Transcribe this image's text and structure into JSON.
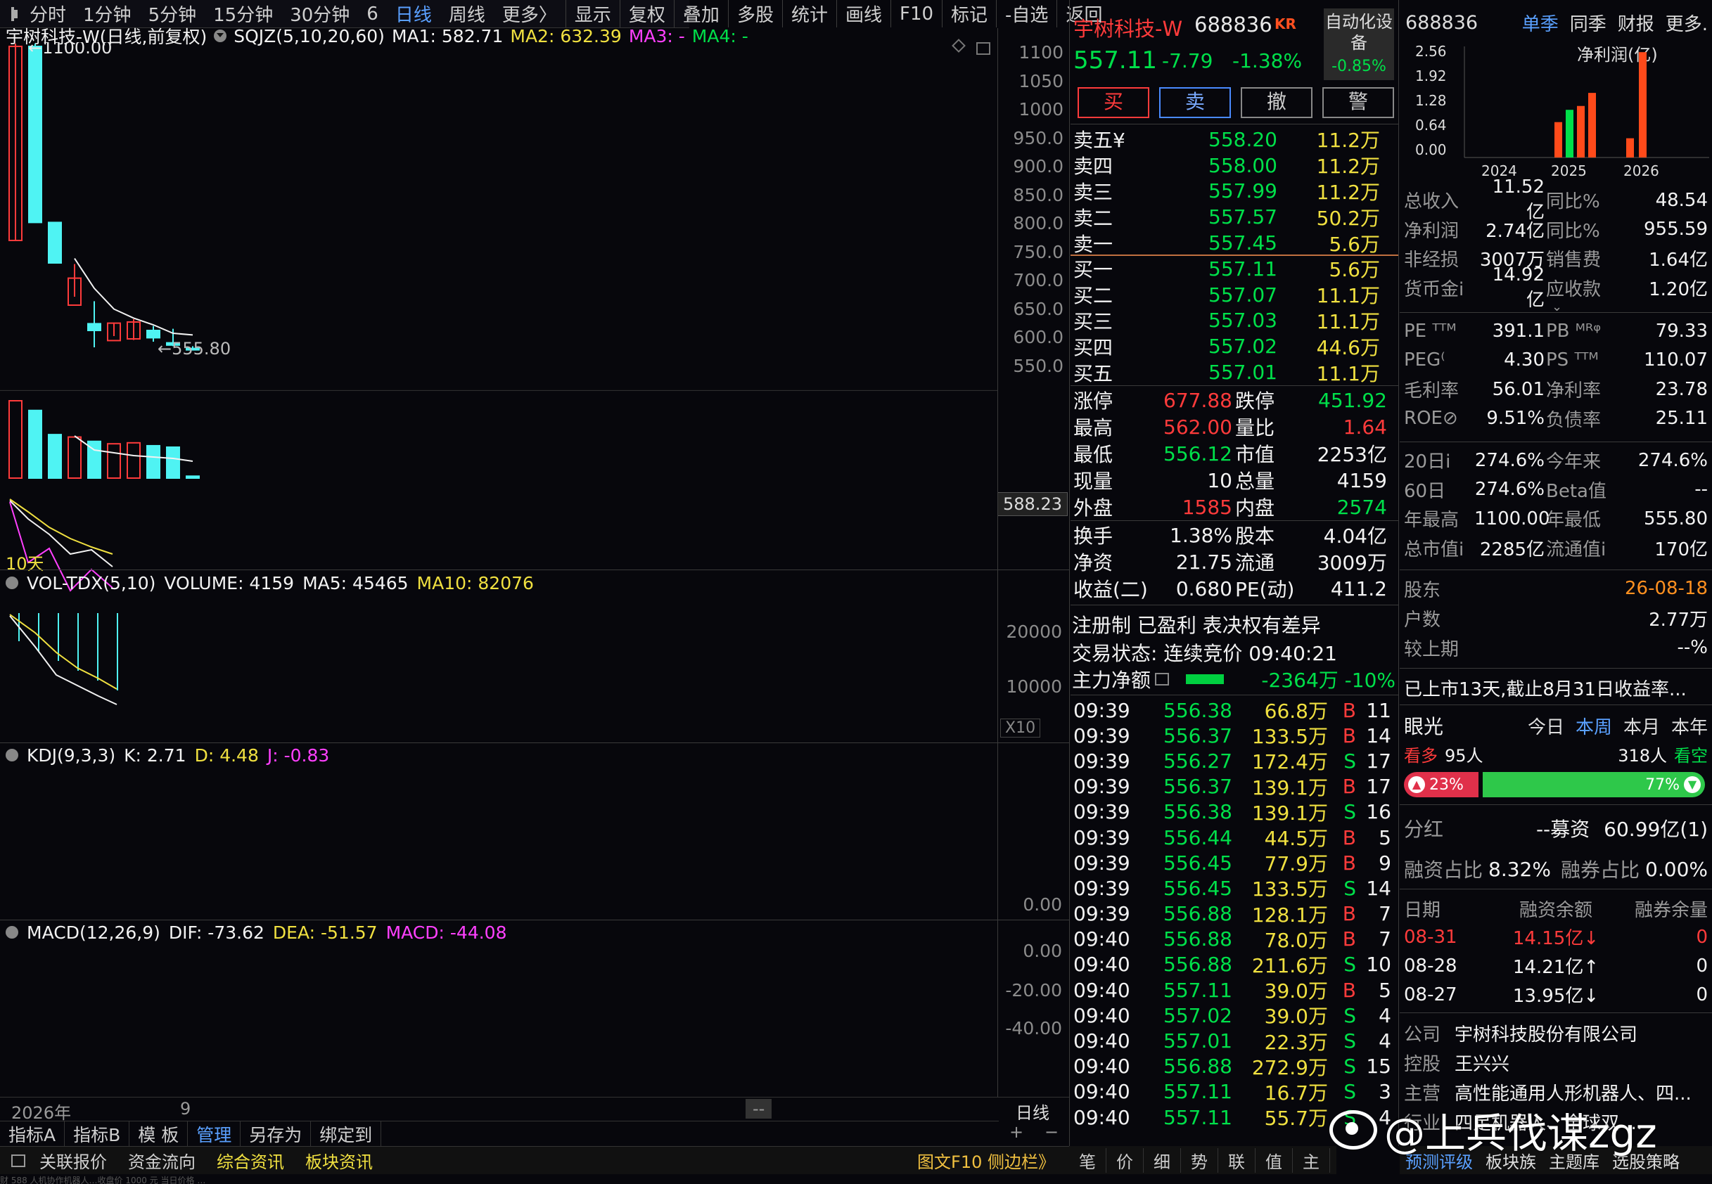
{
  "timeframes": [
    "分时",
    "1分钟",
    "5分钟",
    "15分钟",
    "30分钟",
    "6",
    "日线",
    "周线",
    "更多〉"
  ],
  "toolbar": [
    "显示",
    "复权",
    "叠加",
    "多股",
    "统计",
    "画线",
    "F10",
    "标记",
    "-自选",
    "返回"
  ],
  "chart_header": {
    "title": "宇树科技-W(日线,前复权)",
    "ind": "SQJZ(5,10,20,60)",
    "ma1": "MA1: 582.71",
    "ma2": "MA2: 632.39",
    "ma3": "MA3: -",
    "ma4": "MA4: -"
  },
  "price_axis": [
    "1100",
    "1050",
    "1000",
    "950.0",
    "900.0",
    "850.0",
    "800.0",
    "750.0",
    "700.0",
    "650.0",
    "600.0",
    "550.0"
  ],
  "hi_label": "1100.00",
  "lo_label": "555.80",
  "cursor_price": "588.23",
  "period_label": "10天",
  "vol": {
    "title": "VOL-TDX(5,10)",
    "volume": "VOLUME: 4159",
    "ma5": "MA5: 45465",
    "ma10": "MA10: 82076",
    "axis": [
      "20000",
      "10000"
    ],
    "unit": "X10"
  },
  "kdj": {
    "title": "KDJ(9,3,3)",
    "k": "K: 2.71",
    "d": "D: 4.48",
    "j": "J: -0.83",
    "axis0": "0.00"
  },
  "macd": {
    "title": "MACD(12,26,9)",
    "dif": "DIF: -73.62",
    "dea": "DEA: -51.57",
    "macd": "MACD: -44.08",
    "axis": [
      "0.00",
      "-20.00",
      "-40.00"
    ]
  },
  "chart_data": {
    "type": "candlestick",
    "x": [
      "1",
      "2",
      "3",
      "4",
      "5",
      "6",
      "7",
      "8",
      "9",
      "10"
    ],
    "open": [
      750,
      1095,
      782,
      635,
      590,
      572,
      575,
      590,
      568,
      558
    ],
    "high": [
      1100,
      1100,
      782,
      708,
      642,
      604,
      610,
      598,
      593,
      562
    ],
    "low": [
      750,
      882,
      752,
      650,
      560,
      580,
      573,
      570,
      562,
      556.12
    ],
    "close": [
      1095,
      782,
      710,
      683,
      602,
      603,
      605,
      577,
      564,
      557.11
    ],
    "up": [
      true,
      false,
      false,
      true,
      false,
      true,
      true,
      false,
      false,
      false
    ],
    "volume": [
      16000,
      14000,
      9000,
      8500,
      7600,
      7100,
      7300,
      6700,
      6400,
      400
    ],
    "ylim": [
      550,
      1100
    ]
  },
  "timeline_year": "2026年",
  "timeline_mark": "9",
  "timeline_nav": "--",
  "bottom_period": "日线",
  "bottom_tabs": [
    "指标A",
    "指标B",
    "模 板",
    "管理",
    "另存为",
    "绑定到"
  ],
  "footer_links": [
    "关联报价",
    "资金流向",
    "综合资讯",
    "板块资讯"
  ],
  "footer_right": "图文F10 侧边栏》",
  "footer_tabs": [
    "笔",
    "价",
    "细",
    "势",
    "联",
    "值",
    "主"
  ],
  "watermark": "@上兵伐谋zgz",
  "ticker": "财 588 人机协作机器人…收盘价 1000 元 当日价格 …",
  "quote": {
    "name": "宇树科技-W",
    "code": "688836",
    "tag": "KR",
    "price": "557.11",
    "change": "-7.79",
    "pct": "-1.38%",
    "auto_label": "自动化设备",
    "auto_pct": "-0.85%",
    "btn_buy": "买",
    "btn_sell": "卖",
    "btn_cancel": "撤",
    "btn_alert": "警"
  },
  "asks": [
    {
      "l": "卖五¥",
      "p": "558.20",
      "v": "11.2万"
    },
    {
      "l": "卖四",
      "p": "558.00",
      "v": "11.2万"
    },
    {
      "l": "卖三",
      "p": "557.99",
      "v": "11.2万"
    },
    {
      "l": "卖二",
      "p": "557.57",
      "v": "50.2万"
    },
    {
      "l": "卖一",
      "p": "557.45",
      "v": "5.6万"
    }
  ],
  "bids": [
    {
      "l": "买一",
      "p": "557.11",
      "v": "5.6万"
    },
    {
      "l": "买二",
      "p": "557.07",
      "v": "11.1万"
    },
    {
      "l": "买三",
      "p": "557.03",
      "v": "11.1万"
    },
    {
      "l": "买四",
      "p": "557.02",
      "v": "44.6万"
    },
    {
      "l": "买五",
      "p": "557.01",
      "v": "11.1万"
    }
  ],
  "stats1": [
    [
      "涨停",
      "677.88",
      "跌停",
      "451.92"
    ],
    [
      "最高",
      "562.00",
      "量比",
      "1.64"
    ],
    [
      "最低",
      "556.12",
      "市值",
      "2253亿"
    ],
    [
      "现量",
      "10",
      "总量",
      "4159"
    ],
    [
      "外盘",
      "1585",
      "内盘",
      "2574"
    ]
  ],
  "stats2": [
    [
      "换手",
      "1.38%",
      "股本",
      "4.04亿"
    ],
    [
      "净资",
      "21.75",
      "流通",
      "3009万"
    ],
    [
      "收益(二)",
      "0.680",
      "PE(动)",
      "411.2"
    ]
  ],
  "tags": "注册制 已盈利 表决权有差异",
  "status": "交易状态: 连续竞价 09:40:21",
  "capital": {
    "label": "主力净额",
    "val": "-2364万 -10%"
  },
  "ticks": [
    [
      "09:39",
      "556.38",
      "66.8万",
      "B",
      "11"
    ],
    [
      "09:39",
      "556.37",
      "133.5万",
      "B",
      "14"
    ],
    [
      "09:39",
      "556.27",
      "172.4万",
      "S",
      "17"
    ],
    [
      "09:39",
      "556.37",
      "139.1万",
      "B",
      "17"
    ],
    [
      "09:39",
      "556.38",
      "139.1万",
      "S",
      "16"
    ],
    [
      "09:39",
      "556.44",
      "44.5万",
      "B",
      "5"
    ],
    [
      "09:39",
      "556.45",
      "77.9万",
      "B",
      "9"
    ],
    [
      "09:39",
      "556.45",
      "133.5万",
      "S",
      "14"
    ],
    [
      "09:39",
      "556.88",
      "128.1万",
      "B",
      "7"
    ],
    [
      "09:40",
      "556.88",
      "78.0万",
      "B",
      "7"
    ],
    [
      "09:40",
      "556.88",
      "211.6万",
      "S",
      "10"
    ],
    [
      "09:40",
      "557.11",
      "39.0万",
      "B",
      "5"
    ],
    [
      "09:40",
      "557.02",
      "39.0万",
      "S",
      "4"
    ],
    [
      "09:40",
      "557.01",
      "22.3万",
      "S",
      "4"
    ],
    [
      "09:40",
      "556.88",
      "272.9万",
      "S",
      "15"
    ],
    [
      "09:40",
      "557.11",
      "16.7万",
      "S",
      "3"
    ],
    [
      "09:40",
      "557.11",
      "55.7万",
      "S",
      "4"
    ]
  ],
  "fin_header": {
    "code": "688836",
    "tabs": [
      "单季",
      "同季",
      "财报",
      "更多."
    ],
    "chart_title": "净利润(亿)",
    "yaxis": [
      "2.56",
      "1.92",
      "1.28",
      "0.64",
      "0.00"
    ],
    "years": [
      "2024",
      "2025",
      "2026"
    ]
  },
  "fin_bars": {
    "type": "bar",
    "categories": [
      "2024Q4",
      "2025Q1",
      "2025Q2",
      "2025Q3",
      "2025Q4",
      "2026Q1",
      "2026Q2"
    ],
    "values": [
      0.92,
      1.24,
      1.34,
      1.68,
      0,
      0.5,
      2.74
    ],
    "colors": [
      "#ff4a1a",
      "#00e04a",
      "#ff4a1a",
      "#ff4a1a",
      "#00e04a",
      "#ff4a1a",
      "#ff4a1a"
    ]
  },
  "fin1": [
    [
      "总收入",
      "11.52亿",
      "同比%",
      "48.54"
    ],
    [
      "净利润",
      "2.74亿",
      "同比%",
      "955.59"
    ],
    [
      "非经损",
      "3007万",
      "销售费",
      "1.64亿"
    ],
    [
      "货币金i",
      "14.92亿",
      "应收款",
      "1.20亿"
    ]
  ],
  "fin2": [
    [
      "PE ᵀᵀᴹ",
      "391.1",
      "PB ᴹᴿᵠ",
      "79.33"
    ],
    [
      "PEG⁽",
      "4.30",
      "PS ᵀᵀᴹ",
      "110.07"
    ],
    [
      "毛利率",
      "56.01",
      "净利率",
      "23.78"
    ],
    [
      "ROE⊘",
      "9.51%",
      "负债率",
      "25.11"
    ]
  ],
  "fin3": [
    [
      "20日i",
      "274.6%",
      "今年来",
      "274.6%"
    ],
    [
      "60日",
      "274.6%",
      "Beta值",
      "--"
    ],
    [
      "年最高",
      "1100.00",
      "年最低",
      "555.80"
    ],
    [
      "总市值i",
      "2285亿",
      "流通值i",
      "170亿"
    ]
  ],
  "holders": [
    [
      "股东",
      "26-08-18"
    ],
    [
      "户数",
      "2.77万"
    ],
    [
      "较上期",
      "--%"
    ]
  ],
  "listed": "已上市13天,截止8月31日收益率...",
  "sentiment": {
    "label": "眼光",
    "periods": [
      "今日",
      "本周",
      "本月",
      "本年"
    ],
    "bull": "看多",
    "bull_n": "95人",
    "bear_n": "318人",
    "bear": "看空",
    "bull_pct": "23%",
    "bear_pct": "77%"
  },
  "dividend": {
    "label": "分红",
    "mid": "--募资",
    "val": "60.99亿(1)"
  },
  "margin_ratio": {
    "a": "融资占比",
    "av": "8.32%",
    "b": "融券占比",
    "bv": "0.00%"
  },
  "margin_head": [
    "日期",
    "融资余额",
    "融券余量"
  ],
  "margin_rows": [
    [
      "08-31",
      "14.15亿↓",
      "0"
    ],
    [
      "08-28",
      "14.21亿↑",
      "0"
    ],
    [
      "08-27",
      "13.95亿↓",
      "0"
    ]
  ],
  "company": [
    [
      "公司",
      "宇树科技股份有限公司"
    ],
    [
      "控股",
      "王兴兴"
    ],
    [
      "主营",
      "高性能通用人形机器人、四..."
    ],
    [
      "行业",
      "四足机器人、全球双 ..."
    ]
  ],
  "bottom_right": [
    "预测评级",
    "板块族",
    "主题库",
    "选股策略"
  ]
}
